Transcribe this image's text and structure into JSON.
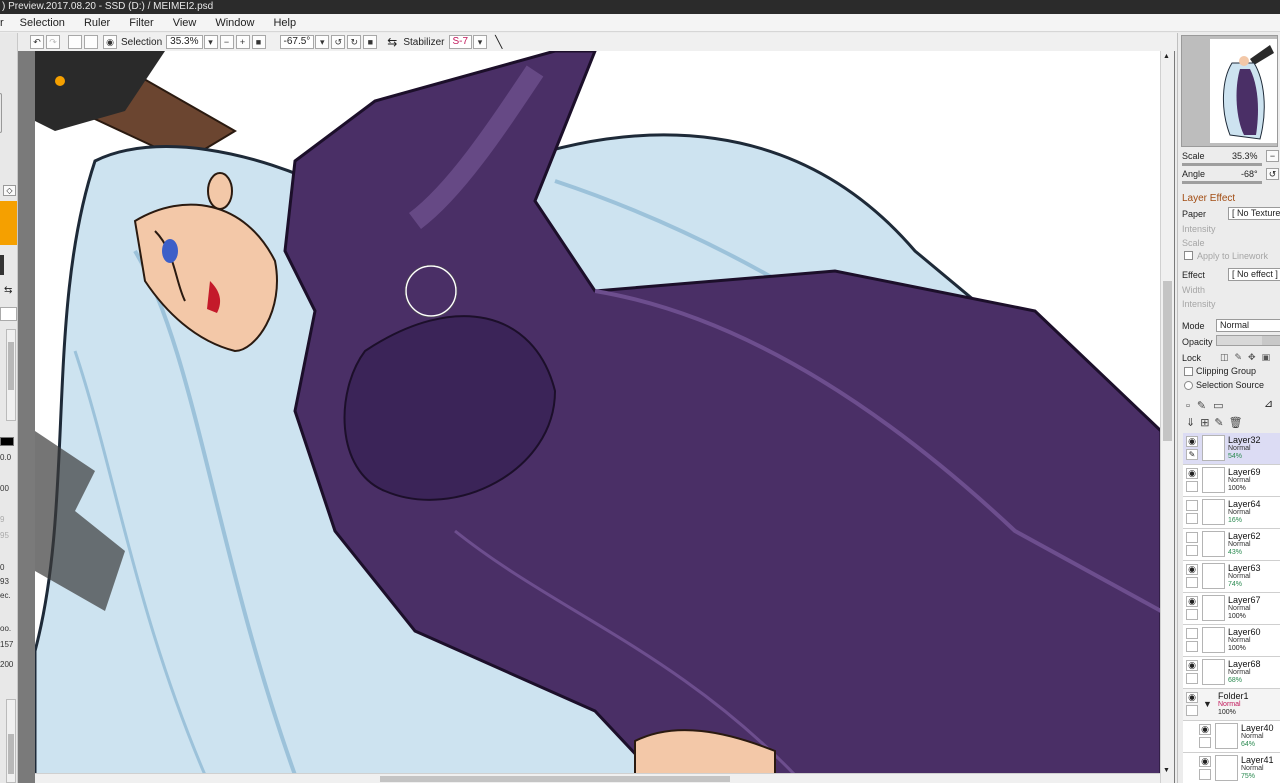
{
  "window": {
    "title": ") Preview.2017.08.20 - SSD (D:) / MEIMEI2.psd"
  },
  "menu": {
    "items": [
      "r",
      "Selection",
      "Ruler",
      "Filter",
      "View",
      "Window",
      "Help"
    ]
  },
  "toolbar": {
    "selection_label": "Selection",
    "zoom_value": "35.3%",
    "zoom_minus": "−",
    "zoom_plus": "+",
    "angle_value": "-67.5°",
    "stabilizer_label": "Stabilizer",
    "stabilizer_value": "S-7"
  },
  "left_panel": {
    "values": [
      "0.0",
      "00",
      "9",
      "95",
      "0",
      "93",
      "ec.",
      "oo.",
      "157",
      "200"
    ]
  },
  "navigator": {
    "scale_label": "Scale",
    "scale_value": "35.3%",
    "angle_label": "Angle",
    "angle_value": "-68°"
  },
  "layer_effect": {
    "title": "Layer Effect",
    "paper_label": "Paper",
    "paper_value": "[ No Texture",
    "intensity_label": "Intensity",
    "scale_label": "Scale",
    "apply_linework_label": "Apply to Linework",
    "effect_label": "Effect",
    "effect_value": "[ No effect ]",
    "width_label": "Width",
    "intensity2_label": "Intensity"
  },
  "layer_props": {
    "mode_label": "Mode",
    "mode_value": "Normal",
    "opacity_label": "Opacity",
    "lock_label": "Lock",
    "clipping_label": "Clipping Group",
    "selection_source_label": "Selection Source"
  },
  "layers": [
    {
      "name": "Layer32",
      "mode": "Normal",
      "opacity": "54%",
      "visible": true,
      "selected": true
    },
    {
      "name": "Layer69",
      "mode": "Normal",
      "opacity": "100%",
      "visible": true
    },
    {
      "name": "Layer64",
      "mode": "Normal",
      "opacity": "16%",
      "visible": false
    },
    {
      "name": "Layer62",
      "mode": "Normal",
      "opacity": "43%",
      "visible": false
    },
    {
      "name": "Layer63",
      "mode": "Normal",
      "opacity": "74%",
      "visible": true
    },
    {
      "name": "Layer67",
      "mode": "Normal",
      "opacity": "100%",
      "visible": true
    },
    {
      "name": "Layer60",
      "mode": "Normal",
      "opacity": "100%",
      "visible": false
    },
    {
      "name": "Layer68",
      "mode": "Normal",
      "opacity": "68%",
      "visible": true
    },
    {
      "name": "Folder1",
      "mode": "Normal",
      "opacity": "100%",
      "visible": true,
      "folder": true
    },
    {
      "name": "Layer40",
      "mode": "Normal",
      "opacity": "64%",
      "visible": true,
      "indent": true
    },
    {
      "name": "Layer41",
      "mode": "Normal",
      "opacity": "75%",
      "visible": true,
      "indent": true
    }
  ],
  "colors": {
    "accent_orange": "#f5a000",
    "hair_blue": "#cde3f0",
    "dress_purple": "#4a2f66",
    "section_title": "#a24c12"
  }
}
